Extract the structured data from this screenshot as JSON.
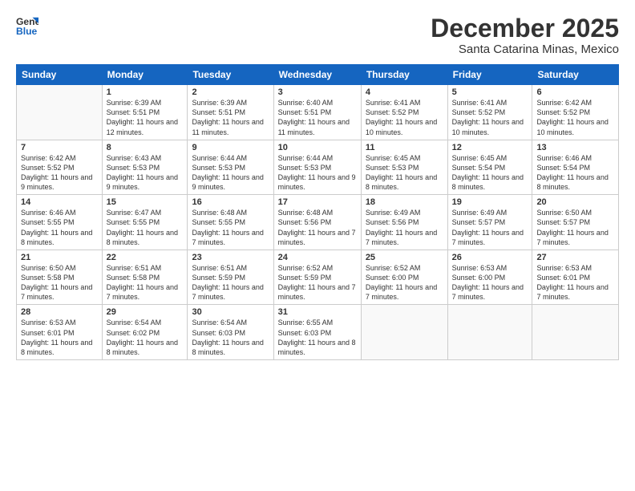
{
  "logo": {
    "line1": "General",
    "line2": "Blue"
  },
  "title": "December 2025",
  "location": "Santa Catarina Minas, Mexico",
  "weekdays": [
    "Sunday",
    "Monday",
    "Tuesday",
    "Wednesday",
    "Thursday",
    "Friday",
    "Saturday"
  ],
  "weeks": [
    [
      {
        "day": "",
        "sunrise": "",
        "sunset": "",
        "daylight": ""
      },
      {
        "day": "1",
        "sunrise": "Sunrise: 6:39 AM",
        "sunset": "Sunset: 5:51 PM",
        "daylight": "Daylight: 11 hours and 12 minutes."
      },
      {
        "day": "2",
        "sunrise": "Sunrise: 6:39 AM",
        "sunset": "Sunset: 5:51 PM",
        "daylight": "Daylight: 11 hours and 11 minutes."
      },
      {
        "day": "3",
        "sunrise": "Sunrise: 6:40 AM",
        "sunset": "Sunset: 5:51 PM",
        "daylight": "Daylight: 11 hours and 11 minutes."
      },
      {
        "day": "4",
        "sunrise": "Sunrise: 6:41 AM",
        "sunset": "Sunset: 5:52 PM",
        "daylight": "Daylight: 11 hours and 10 minutes."
      },
      {
        "day": "5",
        "sunrise": "Sunrise: 6:41 AM",
        "sunset": "Sunset: 5:52 PM",
        "daylight": "Daylight: 11 hours and 10 minutes."
      },
      {
        "day": "6",
        "sunrise": "Sunrise: 6:42 AM",
        "sunset": "Sunset: 5:52 PM",
        "daylight": "Daylight: 11 hours and 10 minutes."
      }
    ],
    [
      {
        "day": "7",
        "sunrise": "Sunrise: 6:42 AM",
        "sunset": "Sunset: 5:52 PM",
        "daylight": "Daylight: 11 hours and 9 minutes."
      },
      {
        "day": "8",
        "sunrise": "Sunrise: 6:43 AM",
        "sunset": "Sunset: 5:53 PM",
        "daylight": "Daylight: 11 hours and 9 minutes."
      },
      {
        "day": "9",
        "sunrise": "Sunrise: 6:44 AM",
        "sunset": "Sunset: 5:53 PM",
        "daylight": "Daylight: 11 hours and 9 minutes."
      },
      {
        "day": "10",
        "sunrise": "Sunrise: 6:44 AM",
        "sunset": "Sunset: 5:53 PM",
        "daylight": "Daylight: 11 hours and 9 minutes."
      },
      {
        "day": "11",
        "sunrise": "Sunrise: 6:45 AM",
        "sunset": "Sunset: 5:53 PM",
        "daylight": "Daylight: 11 hours and 8 minutes."
      },
      {
        "day": "12",
        "sunrise": "Sunrise: 6:45 AM",
        "sunset": "Sunset: 5:54 PM",
        "daylight": "Daylight: 11 hours and 8 minutes."
      },
      {
        "day": "13",
        "sunrise": "Sunrise: 6:46 AM",
        "sunset": "Sunset: 5:54 PM",
        "daylight": "Daylight: 11 hours and 8 minutes."
      }
    ],
    [
      {
        "day": "14",
        "sunrise": "Sunrise: 6:46 AM",
        "sunset": "Sunset: 5:55 PM",
        "daylight": "Daylight: 11 hours and 8 minutes."
      },
      {
        "day": "15",
        "sunrise": "Sunrise: 6:47 AM",
        "sunset": "Sunset: 5:55 PM",
        "daylight": "Daylight: 11 hours and 8 minutes."
      },
      {
        "day": "16",
        "sunrise": "Sunrise: 6:48 AM",
        "sunset": "Sunset: 5:55 PM",
        "daylight": "Daylight: 11 hours and 7 minutes."
      },
      {
        "day": "17",
        "sunrise": "Sunrise: 6:48 AM",
        "sunset": "Sunset: 5:56 PM",
        "daylight": "Daylight: 11 hours and 7 minutes."
      },
      {
        "day": "18",
        "sunrise": "Sunrise: 6:49 AM",
        "sunset": "Sunset: 5:56 PM",
        "daylight": "Daylight: 11 hours and 7 minutes."
      },
      {
        "day": "19",
        "sunrise": "Sunrise: 6:49 AM",
        "sunset": "Sunset: 5:57 PM",
        "daylight": "Daylight: 11 hours and 7 minutes."
      },
      {
        "day": "20",
        "sunrise": "Sunrise: 6:50 AM",
        "sunset": "Sunset: 5:57 PM",
        "daylight": "Daylight: 11 hours and 7 minutes."
      }
    ],
    [
      {
        "day": "21",
        "sunrise": "Sunrise: 6:50 AM",
        "sunset": "Sunset: 5:58 PM",
        "daylight": "Daylight: 11 hours and 7 minutes."
      },
      {
        "day": "22",
        "sunrise": "Sunrise: 6:51 AM",
        "sunset": "Sunset: 5:58 PM",
        "daylight": "Daylight: 11 hours and 7 minutes."
      },
      {
        "day": "23",
        "sunrise": "Sunrise: 6:51 AM",
        "sunset": "Sunset: 5:59 PM",
        "daylight": "Daylight: 11 hours and 7 minutes."
      },
      {
        "day": "24",
        "sunrise": "Sunrise: 6:52 AM",
        "sunset": "Sunset: 5:59 PM",
        "daylight": "Daylight: 11 hours and 7 minutes."
      },
      {
        "day": "25",
        "sunrise": "Sunrise: 6:52 AM",
        "sunset": "Sunset: 6:00 PM",
        "daylight": "Daylight: 11 hours and 7 minutes."
      },
      {
        "day": "26",
        "sunrise": "Sunrise: 6:53 AM",
        "sunset": "Sunset: 6:00 PM",
        "daylight": "Daylight: 11 hours and 7 minutes."
      },
      {
        "day": "27",
        "sunrise": "Sunrise: 6:53 AM",
        "sunset": "Sunset: 6:01 PM",
        "daylight": "Daylight: 11 hours and 7 minutes."
      }
    ],
    [
      {
        "day": "28",
        "sunrise": "Sunrise: 6:53 AM",
        "sunset": "Sunset: 6:01 PM",
        "daylight": "Daylight: 11 hours and 8 minutes."
      },
      {
        "day": "29",
        "sunrise": "Sunrise: 6:54 AM",
        "sunset": "Sunset: 6:02 PM",
        "daylight": "Daylight: 11 hours and 8 minutes."
      },
      {
        "day": "30",
        "sunrise": "Sunrise: 6:54 AM",
        "sunset": "Sunset: 6:03 PM",
        "daylight": "Daylight: 11 hours and 8 minutes."
      },
      {
        "day": "31",
        "sunrise": "Sunrise: 6:55 AM",
        "sunset": "Sunset: 6:03 PM",
        "daylight": "Daylight: 11 hours and 8 minutes."
      },
      {
        "day": "",
        "sunrise": "",
        "sunset": "",
        "daylight": ""
      },
      {
        "day": "",
        "sunrise": "",
        "sunset": "",
        "daylight": ""
      },
      {
        "day": "",
        "sunrise": "",
        "sunset": "",
        "daylight": ""
      }
    ]
  ]
}
